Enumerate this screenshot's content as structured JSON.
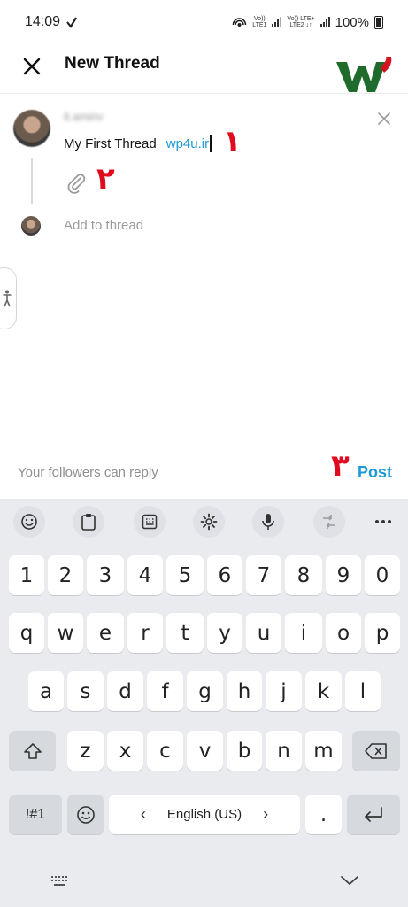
{
  "status": {
    "time": "14:09",
    "sim1": "LTE1",
    "sim2": "LTE2",
    "lte_plus": "LTE+",
    "battery": "100%"
  },
  "header": {
    "title": "New Thread"
  },
  "compose": {
    "username": "it.aminv",
    "text": "My First Thread",
    "link": "wp4u.ir",
    "add_placeholder": "Add to thread",
    "reply_hint": "Your followers can reply",
    "post_label": "Post"
  },
  "annotations": {
    "n1": "١",
    "n2": "٢",
    "n3": "٣"
  },
  "keyboard": {
    "numbers": [
      "1",
      "2",
      "3",
      "4",
      "5",
      "6",
      "7",
      "8",
      "9",
      "0"
    ],
    "row1": [
      "q",
      "w",
      "e",
      "r",
      "t",
      "y",
      "u",
      "i",
      "o",
      "p"
    ],
    "row2": [
      "a",
      "s",
      "d",
      "f",
      "g",
      "h",
      "j",
      "k",
      "l"
    ],
    "row3": [
      "z",
      "x",
      "c",
      "v",
      "b",
      "n",
      "m"
    ],
    "symbols_label": "!#1",
    "space_label": "English (US)",
    "period": ".",
    "left_arrow": "‹",
    "right_arrow": "›"
  },
  "toolbar_icons": [
    "emoji-icon",
    "clipboard-icon",
    "keypad-icon",
    "settings-icon",
    "microphone-icon",
    "translate-icon",
    "more-icon"
  ]
}
